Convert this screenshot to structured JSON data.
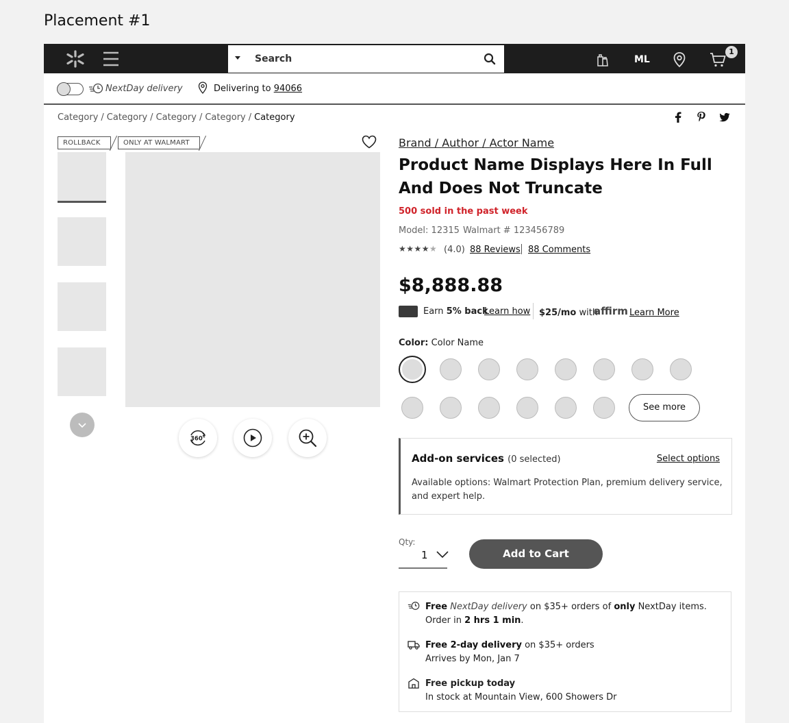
{
  "placement_title": "Placement #1",
  "header": {
    "search_placeholder": "Search",
    "initials": "ML",
    "cart_count": "1"
  },
  "subbar": {
    "nextday_label": "NextDay delivery",
    "delivering_to": "Delivering to",
    "zip": "94066"
  },
  "breadcrumb": [
    "Category",
    "Category",
    "Category",
    "Category",
    "Category"
  ],
  "badges": [
    "ROLLBACK",
    "ONLY AT WALMART"
  ],
  "product": {
    "brand": "Brand / Author / Actor Name",
    "title": "Product Name Displays Here In Full And Does Not Truncate",
    "sold": "500 sold in the past week",
    "model": "Model: 12315",
    "walmart_num": "Walmart # 123456789",
    "stars": "★★★★",
    "star_empty": "★",
    "rating": "(4.0)",
    "reviews": "88 Reviews",
    "comments": "88 Comments",
    "price": "$8,888.88",
    "earn_prefix": "Earn",
    "earn_bold": "5% back",
    "learn_how": "Learn how",
    "affirm_price": "$25/mo",
    "affirm_with": "with",
    "affirm_brand": "affirm",
    "learn_more": "Learn More"
  },
  "color": {
    "label": "Color:",
    "value": "Color Name",
    "see_more": "See more"
  },
  "addon": {
    "title": "Add-on services",
    "count": "(0 selected)",
    "select": "Select options",
    "desc": "Available options: Walmart Protection Plan, premium delivery service, and expert help."
  },
  "qty": {
    "label": "Qty:",
    "value": "1"
  },
  "add_to_cart": "Add to Cart",
  "fulfillment": {
    "nextday_free": "Free",
    "nextday_name": "NextDay delivery",
    "nextday_mid": "on $35+ orders of",
    "nextday_only": "only",
    "nextday_end": "NextDay items.",
    "order_in": "Order in",
    "order_time": "2 hrs 1 min",
    "order_dot": ".",
    "twoday_bold": "Free 2-day delivery",
    "twoday_rest": "on $35+ orders",
    "twoday_arrives": "Arrives by Mon, Jan 7",
    "pickup_bold": "Free pickup today",
    "pickup_rest": "In stock at Mountain View, 600 Showers Dr"
  },
  "icons": {
    "spark": "walmart-spark-icon",
    "menu": "hamburger-menu-icon",
    "search": "search-icon",
    "reorder": "reorder-icon",
    "location": "location-pin-icon",
    "cart": "cart-icon",
    "facebook": "facebook-icon",
    "pinterest": "pinterest-icon",
    "twitter": "twitter-icon",
    "heart": "heart-icon",
    "view360": "view-360-icon",
    "play": "play-icon",
    "zoom": "zoom-in-icon"
  }
}
